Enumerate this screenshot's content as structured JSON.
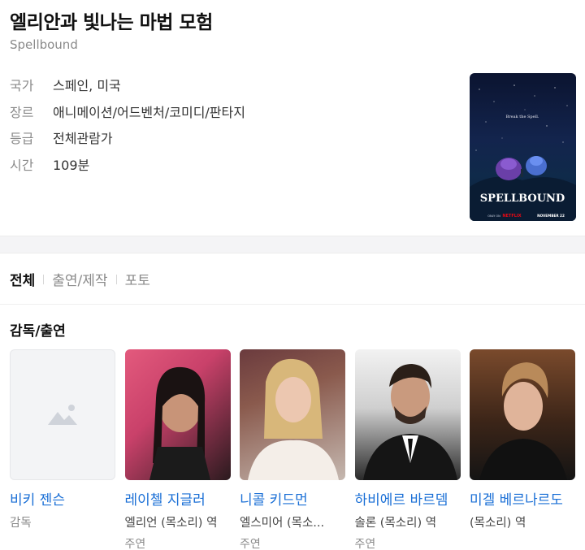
{
  "movie": {
    "title": "엘리안과 빛나는 마법 모험",
    "original_title": "Spellbound"
  },
  "info": [
    {
      "label": "국가",
      "value": "스페인, 미국"
    },
    {
      "label": "장르",
      "value": "애니메이션/어드벤처/코미디/판타지"
    },
    {
      "label": "등급",
      "value": "전체관람가"
    },
    {
      "label": "시간",
      "value": "109분"
    }
  ],
  "poster": {
    "tagline": "Break the Spell.",
    "logo": "SPELLBOUND",
    "network": "NETFLIX",
    "only_on": "ONLY ON",
    "date": "NOVEMBER 22"
  },
  "tabs": [
    {
      "label": "전체",
      "active": true
    },
    {
      "label": "출연/제작",
      "active": false
    },
    {
      "label": "포토",
      "active": false
    }
  ],
  "section_title": "감독/출연",
  "cast": [
    {
      "name": "비키 젠슨",
      "role": "감독",
      "type": "",
      "has_photo": false
    },
    {
      "name": "레이첼 지글러",
      "role": "엘리언 (목소리) 역",
      "type": "주연",
      "has_photo": true
    },
    {
      "name": "니콜 키드먼",
      "role": "엘스미어 (목소...",
      "type": "주연",
      "has_photo": true
    },
    {
      "name": "하비에르 바르뎀",
      "role": "솔론 (목소리) 역",
      "type": "주연",
      "has_photo": true
    },
    {
      "name": "미겔 베르나르도",
      "role": "(목소리) 역",
      "type": "",
      "has_photo": true
    }
  ],
  "colors": {
    "link": "#1a6fd6",
    "muted": "#8a8a8a",
    "band": "#f4f4f6"
  }
}
